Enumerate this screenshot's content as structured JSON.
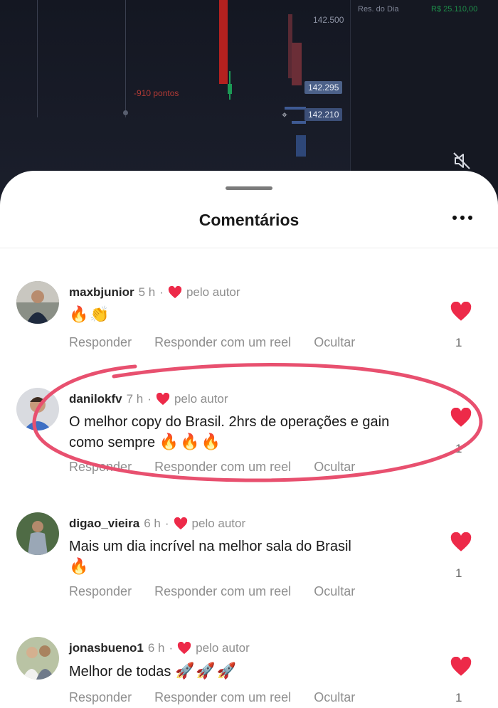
{
  "chart": {
    "price_top": "142.500",
    "points_label": "-910 pontos",
    "result_label": "Res. do Dia",
    "result_value": "R$ 25.110,00",
    "tag_price_1": "142.295",
    "tag_price_2": "142.210",
    "colors": {
      "bg": "#151822",
      "red": "#b4211f",
      "green": "#1c9a55",
      "tag": "#4c6189"
    }
  },
  "sheet": {
    "title": "Comentários",
    "more_icon": "more-horizontal-icon"
  },
  "comments": [
    {
      "user": "maxbjunior",
      "time": "5 h",
      "author_badge": "pelo autor",
      "text": "",
      "emoji": "🔥👏",
      "actions": [
        "Responder",
        "Responder com um reel",
        "Ocultar"
      ],
      "likes": "1"
    },
    {
      "user": "danilokfv",
      "time": "7 h",
      "author_badge": "pelo autor",
      "text": "O melhor copy do Brasil. 2hrs de operações e gain como sempre",
      "emoji": "🔥🔥🔥",
      "actions": [
        "Responder",
        "Responder com um reel",
        "Ocultar"
      ],
      "likes": "1"
    },
    {
      "user": "digao_vieira",
      "time": "6 h",
      "author_badge": "pelo autor",
      "text": "Mais um dia incrível na melhor sala do Brasil",
      "emoji": "🔥",
      "actions": [
        "Responder",
        "Responder com um reel",
        "Ocultar"
      ],
      "likes": "1"
    },
    {
      "user": "jonasbueno1",
      "time": "6 h",
      "author_badge": "pelo autor",
      "text": "Melhor de todas",
      "emoji": "🚀🚀🚀",
      "actions": [
        "Responder",
        "Responder com um reel",
        "Ocultar"
      ],
      "likes": "1"
    }
  ],
  "colors": {
    "like_red": "#ed2a49",
    "highlight": "#e8506f",
    "muted_text": "#8e8e8e"
  }
}
